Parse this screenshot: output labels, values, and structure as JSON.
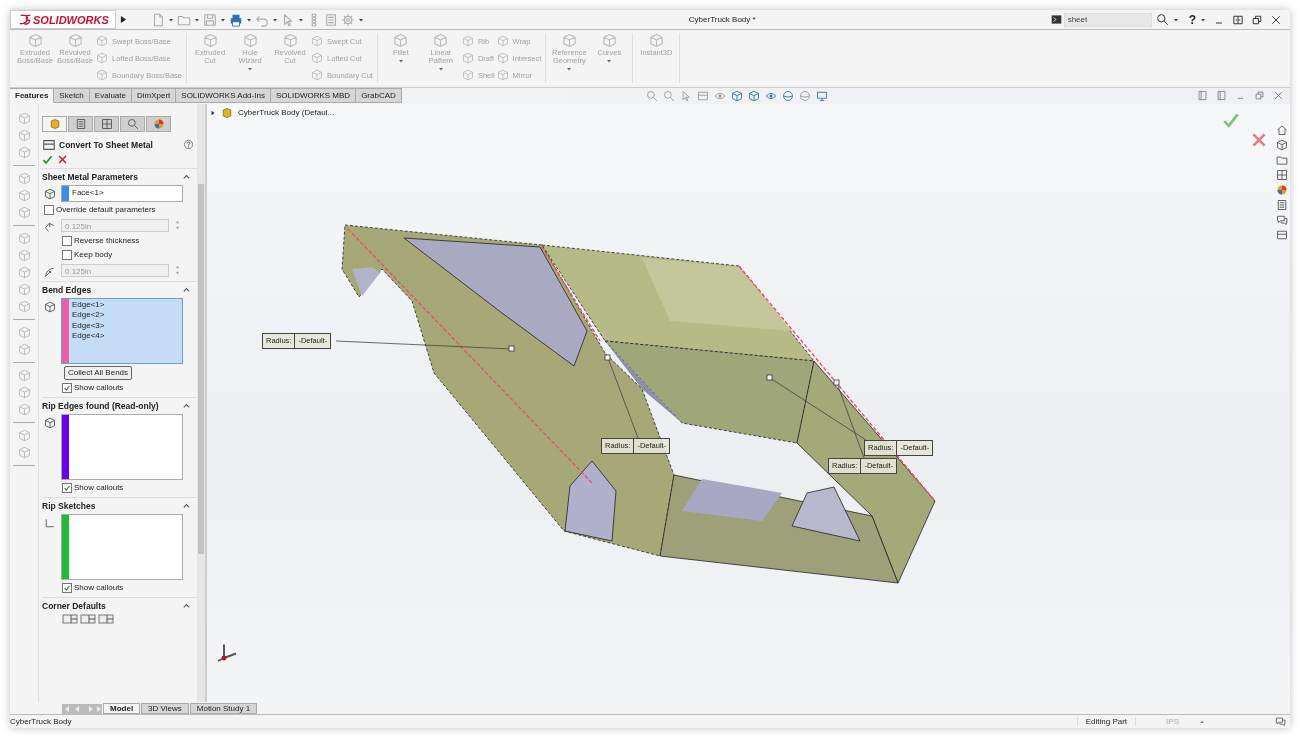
{
  "window": {
    "logo": "SOLIDWORKS",
    "title": "CyberTruck Body *",
    "help": "?"
  },
  "search": {
    "value": "sheet"
  },
  "ribbon": {
    "groups": [
      {
        "items": [
          {
            "kind": "large",
            "label": "Extruded Boss/Base",
            "dropdown": false,
            "disabled": true
          },
          {
            "kind": "large",
            "label": "Revolved Boss/Base",
            "dropdown": false,
            "disabled": true
          },
          {
            "kind": "stack",
            "items": [
              {
                "label": "Swept Boss/Base",
                "disabled": true
              },
              {
                "label": "Lofted Boss/Base",
                "disabled": true
              },
              {
                "label": "Boundary Boss/Base",
                "disabled": true
              }
            ]
          }
        ]
      },
      {
        "items": [
          {
            "kind": "large",
            "label": "Extruded Cut",
            "dropdown": false,
            "disabled": true
          },
          {
            "kind": "large",
            "label": "Hole Wizard",
            "dropdown": true,
            "disabled": true
          },
          {
            "kind": "large",
            "label": "Revolved Cut",
            "dropdown": false,
            "disabled": true
          },
          {
            "kind": "stack",
            "items": [
              {
                "label": "Swept Cut",
                "disabled": true
              },
              {
                "label": "Lofted Cut",
                "disabled": true
              },
              {
                "label": "Boundary Cut",
                "disabled": true
              }
            ]
          }
        ]
      },
      {
        "items": [
          {
            "kind": "large",
            "label": "Fillet",
            "dropdown": true,
            "disabled": true
          },
          {
            "kind": "large",
            "label": "Linear Pattern",
            "dropdown": true,
            "disabled": true
          },
          {
            "kind": "stack",
            "items": [
              {
                "label": "Rib",
                "disabled": true
              },
              {
                "label": "Draft",
                "disabled": true
              },
              {
                "label": "Shell",
                "disabled": true
              }
            ]
          },
          {
            "kind": "stack",
            "items": [
              {
                "label": "Wrap",
                "disabled": true
              },
              {
                "label": "Intersect",
                "disabled": true
              },
              {
                "label": "Mirror",
                "disabled": true
              }
            ]
          }
        ]
      },
      {
        "items": [
          {
            "kind": "large",
            "label": "Reference Geometry",
            "dropdown": true,
            "disabled": true
          },
          {
            "kind": "large",
            "label": "Curves",
            "dropdown": true,
            "disabled": true
          }
        ]
      },
      {
        "items": [
          {
            "kind": "large",
            "label": "Instant3D",
            "dropdown": false,
            "disabled": true
          }
        ]
      }
    ]
  },
  "command_tabs": [
    {
      "label": "Features",
      "selected": true
    },
    {
      "label": "Sketch",
      "selected": false
    },
    {
      "label": "Evaluate",
      "selected": false
    },
    {
      "label": "DimXpert",
      "selected": false
    },
    {
      "label": "SOLIDWORKS Add-Ins",
      "selected": false
    },
    {
      "label": "SOLIDWORKS MBD",
      "selected": false
    },
    {
      "label": "GrabCAD",
      "selected": false
    }
  ],
  "property_manager": {
    "tabs": [
      {
        "selected": true
      },
      {
        "selected": false
      },
      {
        "selected": false
      },
      {
        "selected": false
      },
      {
        "selected": false
      }
    ],
    "title": "Convert To Sheet Metal",
    "sections": [
      {
        "title": "Sheet Metal Parameters",
        "expanded": true,
        "rows": [
          {
            "kind": "face-select",
            "color": "#3a8ee6",
            "items": [
              "Face<1>"
            ]
          },
          {
            "kind": "checkbox",
            "label": "Override default parameters",
            "checked": false
          },
          {
            "kind": "thickness",
            "value": "0.125in",
            "disabled": true
          },
          {
            "kind": "sub-checkbox",
            "label": "Reverse thickness",
            "checked": false
          },
          {
            "kind": "sub-checkbox",
            "label": "Keep body",
            "checked": false
          },
          {
            "kind": "radius",
            "value": "0.125in",
            "disabled": true
          }
        ]
      },
      {
        "title": "Bend Edges",
        "expanded": true,
        "rows": [
          {
            "kind": "edge-list",
            "color": "#ec5fa8",
            "selected": true,
            "items": [
              "Edge<1>",
              "Edge<2>",
              "Edge<3>",
              "Edge<4>"
            ]
          },
          {
            "kind": "button",
            "label": "Collect All Bends"
          },
          {
            "kind": "sub-checkbox",
            "label": "Show callouts",
            "checked": true
          }
        ]
      },
      {
        "title": "Rip Edges found (Read-only)",
        "expanded": true,
        "rows": [
          {
            "kind": "edge-list",
            "color": "#6a00e6",
            "selected": false
          },
          {
            "kind": "sub-checkbox",
            "label": "Show callouts",
            "checked": true
          }
        ]
      },
      {
        "title": "Rip Sketches",
        "expanded": true,
        "rows": [
          {
            "kind": "sketch-list",
            "color": "#22b83a",
            "selected": false
          },
          {
            "kind": "sub-checkbox",
            "label": "Show callouts",
            "checked": true
          }
        ]
      },
      {
        "title": "Corner Defaults",
        "expanded": true,
        "rows": [
          {
            "kind": "corner-icons"
          }
        ]
      }
    ]
  },
  "feature_tree": {
    "label": "CyberTruck Body  (Defaul..."
  },
  "callouts": [
    {
      "label": "Radius:",
      "value": "-Default-"
    },
    {
      "label": "Radius:",
      "value": "-Default-"
    },
    {
      "label": "Radius:",
      "value": "-Default-"
    },
    {
      "label": "Radius:",
      "value": "-Default-"
    }
  ],
  "bottom_tabs": [
    {
      "label": "Model",
      "selected": true
    },
    {
      "label": "3D Views",
      "selected": false
    },
    {
      "label": "Motion Study 1",
      "selected": false
    }
  ],
  "status_bar": {
    "document": "CyberTruck Body",
    "mode": "Editing Part",
    "units": "IPS"
  }
}
